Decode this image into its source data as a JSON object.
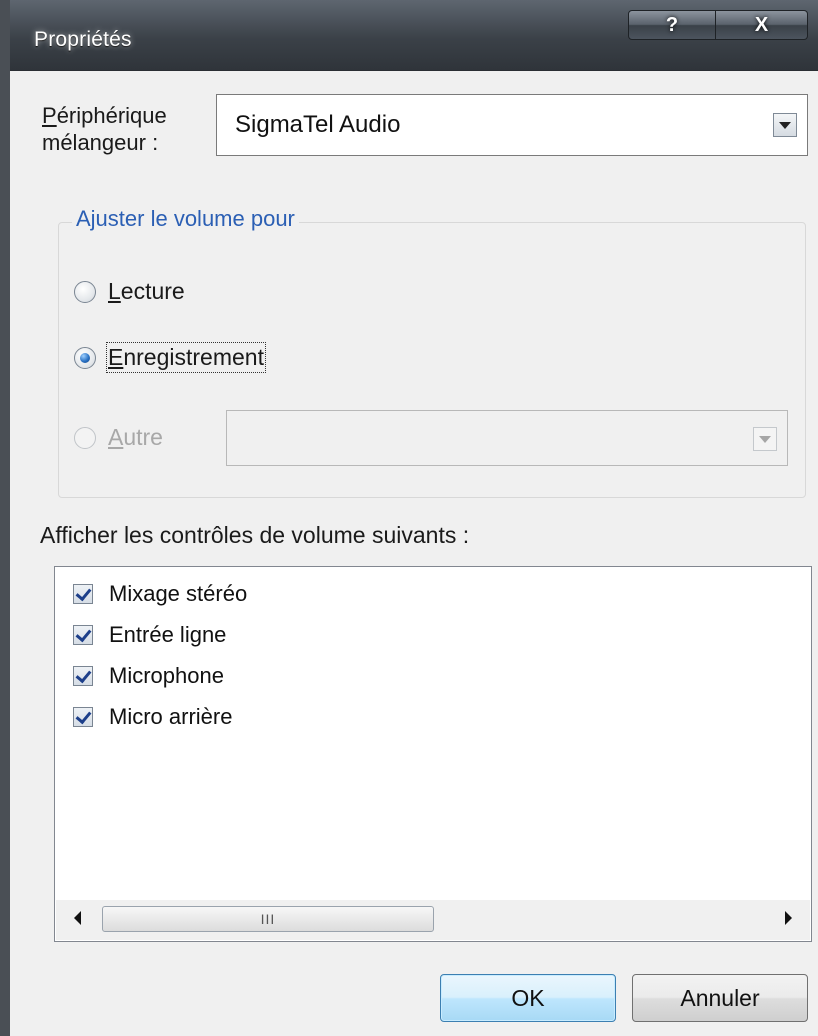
{
  "window": {
    "title": "Propriétés",
    "help_button": "?",
    "close_button": "X"
  },
  "mixer": {
    "label_first_letter": "P",
    "label_line1_rest": "ériphérique",
    "label_line2": "mélangeur :",
    "selected": "SigmaTel Audio"
  },
  "volume_group": {
    "legend": "Ajuster le volume pour",
    "options": [
      {
        "mnemonic": "L",
        "rest": "ecture",
        "checked": false,
        "enabled": true
      },
      {
        "mnemonic": "E",
        "rest": "nregistrement",
        "checked": true,
        "enabled": true
      },
      {
        "mnemonic": "A",
        "rest": "utre",
        "checked": false,
        "enabled": false
      }
    ],
    "other_value": ""
  },
  "controls": {
    "label": "Afficher les contrôles de volume suivants :",
    "items": [
      {
        "label": "Mixage stéréo",
        "checked": true
      },
      {
        "label": "Entrée ligne",
        "checked": true
      },
      {
        "label": "Microphone",
        "checked": true
      },
      {
        "label": "Micro arrière",
        "checked": true
      }
    ],
    "scroll_grip": "III"
  },
  "buttons": {
    "ok": "OK",
    "cancel": "Annuler"
  },
  "colors": {
    "accent": "#2b5fb4",
    "titlebar": "#3b4148",
    "checkmark": "#1d3f8a"
  }
}
